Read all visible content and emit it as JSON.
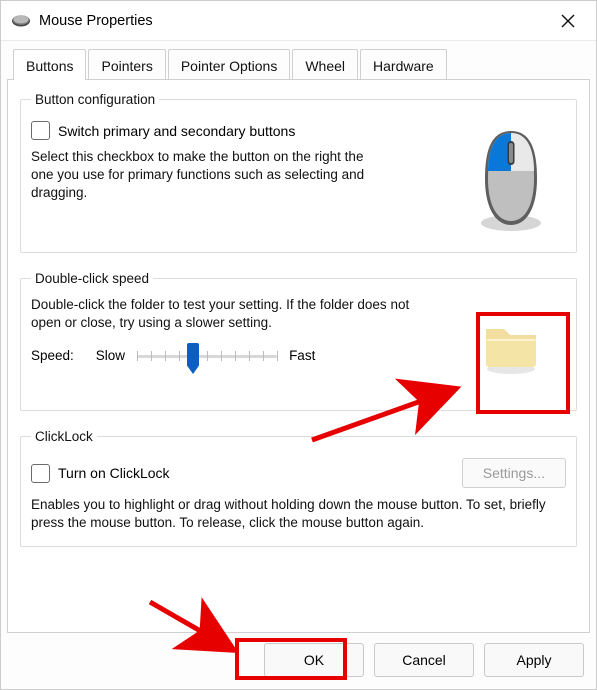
{
  "window": {
    "title": "Mouse Properties"
  },
  "tabs": [
    {
      "label": "Buttons"
    },
    {
      "label": "Pointers"
    },
    {
      "label": "Pointer Options"
    },
    {
      "label": "Wheel"
    },
    {
      "label": "Hardware"
    }
  ],
  "button_config": {
    "legend": "Button configuration",
    "checkbox_label": "Switch primary and secondary buttons",
    "help": "Select this checkbox to make the button on the right the one you use for primary functions such as selecting and dragging."
  },
  "double_click": {
    "legend": "Double-click speed",
    "help": "Double-click the folder to test your setting. If the folder does not open or close, try using a slower setting.",
    "speed_label": "Speed:",
    "slow_label": "Slow",
    "fast_label": "Fast",
    "value_percent": 40
  },
  "clicklock": {
    "legend": "ClickLock",
    "checkbox_label": "Turn on ClickLock",
    "settings_button": "Settings...",
    "help": "Enables you to highlight or drag without holding down the mouse button. To set, briefly press the mouse button. To release, click the mouse button again."
  },
  "buttons": {
    "ok": "OK",
    "cancel": "Cancel",
    "apply": "Apply"
  },
  "annotations": {
    "arrow_color": "#e60000"
  }
}
